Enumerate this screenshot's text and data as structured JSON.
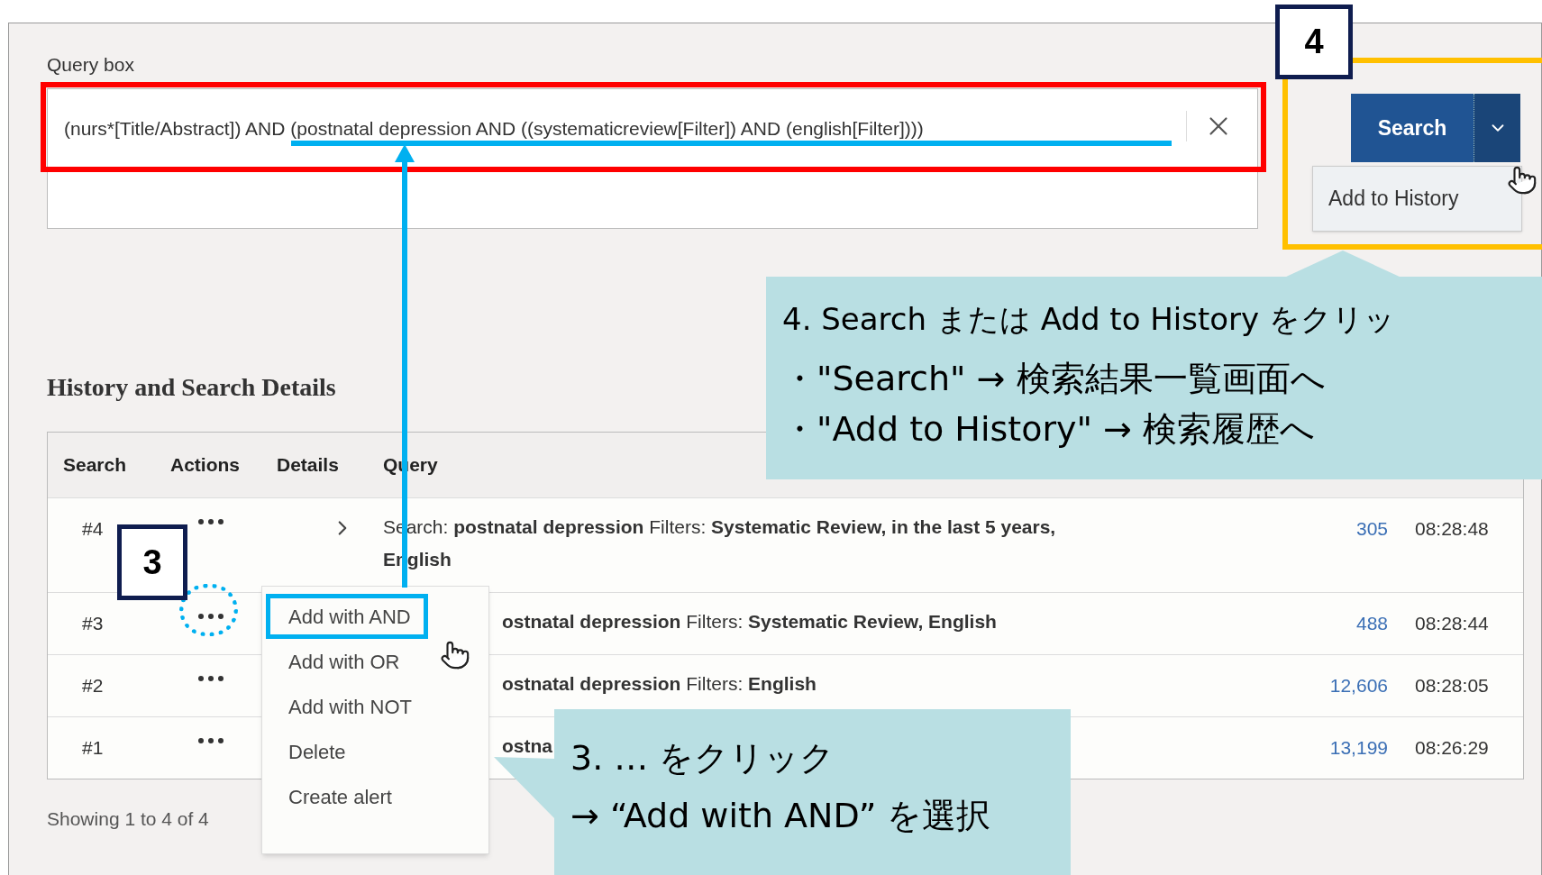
{
  "query_box": {
    "label": "Query box",
    "value": "(nurs*[Title/Abstract]) AND (postnatal depression AND ((systematicreview[Filter]) AND (english[Filter])))"
  },
  "search_button": {
    "label": "Search"
  },
  "search_dropdown": {
    "expanded": true,
    "items": [
      "Add to History"
    ]
  },
  "history": {
    "title": "History and Search Details",
    "columns": [
      "Search",
      "Actions",
      "Details",
      "Query"
    ],
    "rows": [
      {
        "number": "#4",
        "kind": "full",
        "details": true,
        "query": "Search: **postnatal depression** Filters: **Systematic Review, in the last 5 years, English**",
        "results": "305",
        "time": "08:28:48"
      },
      {
        "number": "#3",
        "kind": "covered",
        "details": false,
        "query": "**ostnatal depression** Filters: **Systematic Review, English**",
        "results": "488",
        "time": "08:28:44"
      },
      {
        "number": "#2",
        "kind": "covered",
        "details": false,
        "query": "**ostnatal depression** Filters: **English**",
        "results": "12,606",
        "time": "08:28:05"
      },
      {
        "number": "#1",
        "kind": "covered",
        "details": false,
        "query": "**ostna**",
        "results": "13,199",
        "time": "08:26:29"
      }
    ],
    "footer": "Showing 1 to 4 of 4"
  },
  "actions_menu": {
    "items": [
      {
        "label": "Add with AND",
        "selected": true
      },
      {
        "label": "Add with OR",
        "selected": false
      },
      {
        "label": "Add with NOT",
        "selected": false
      },
      {
        "label": "Delete",
        "selected": false
      },
      {
        "label": "Create alert",
        "selected": false
      }
    ]
  },
  "annotations": {
    "step_4": {
      "number": "4",
      "lines": [
        "4. Search または Add to History をクリッ",
        "・\"Search\" → 検索結果一覧画面へ",
        "・\"Add to History\" → 検索履歴へ"
      ]
    },
    "step_3": {
      "number": "3",
      "lines": [
        "3. … をクリック",
        "→ “Add with AND” を選択"
      ]
    }
  }
}
